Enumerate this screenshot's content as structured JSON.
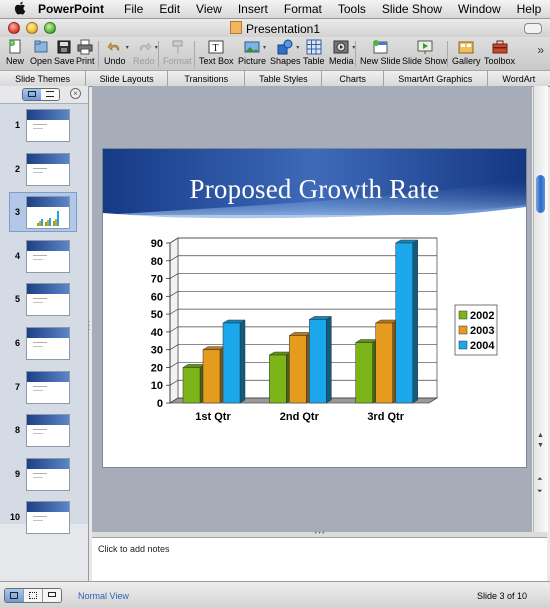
{
  "menu": {
    "apple": "",
    "items": [
      "PowerPoint",
      "File",
      "Edit",
      "View",
      "Insert",
      "Format",
      "Tools",
      "Slide Show",
      "Window",
      "Help"
    ],
    "script_icon": "script-menu-icon"
  },
  "window": {
    "title": "Presentation1"
  },
  "toolbar": {
    "new": "New",
    "open": "Open",
    "save": "Save",
    "print": "Print",
    "undo": "Undo",
    "redo": "Redo",
    "format": "Format",
    "textbox": "Text Box",
    "picture": "Picture",
    "shapes": "Shapes",
    "table": "Table",
    "media": "Media",
    "newslide": "New Slide",
    "slideshow": "Slide Show",
    "gallery": "Gallery",
    "toolbox": "Toolbox",
    "more": "»"
  },
  "ribbon": {
    "tabs": [
      "Slide Themes",
      "Slide Layouts",
      "Transitions",
      "Table Styles",
      "Charts",
      "SmartArt Graphics",
      "WordArt"
    ]
  },
  "sidebar": {
    "slides": [
      {
        "num": "1"
      },
      {
        "num": "2"
      },
      {
        "num": "3"
      },
      {
        "num": "4"
      },
      {
        "num": "5"
      },
      {
        "num": "6"
      },
      {
        "num": "7"
      },
      {
        "num": "8"
      },
      {
        "num": "9"
      },
      {
        "num": "10"
      }
    ],
    "selected": 3
  },
  "slide": {
    "title": "Proposed Growth Rate"
  },
  "notes": {
    "placeholder": "Click to add notes"
  },
  "status": {
    "view": "Normal View",
    "slide_counter": "Slide 3 of 10"
  },
  "colors": {
    "series_2002": "#7cb518",
    "series_2003": "#e59b1e",
    "series_2004": "#1aa7ec",
    "title_band": "#1e4a9a"
  },
  "chart_data": {
    "type": "bar",
    "categories": [
      "1st Qtr",
      "2nd Qtr",
      "3rd Qtr"
    ],
    "series": [
      {
        "name": "2002",
        "values": [
          20,
          27,
          34
        ]
      },
      {
        "name": "2003",
        "values": [
          30,
          38,
          45
        ]
      },
      {
        "name": "2004",
        "values": [
          45,
          47,
          90
        ]
      }
    ],
    "ylim": [
      0,
      90
    ],
    "yticks": [
      "0",
      "10",
      "20",
      "30",
      "40",
      "50",
      "60",
      "70",
      "80",
      "90"
    ],
    "grid": true,
    "legend": "right",
    "style": "3d-clustered-column"
  }
}
